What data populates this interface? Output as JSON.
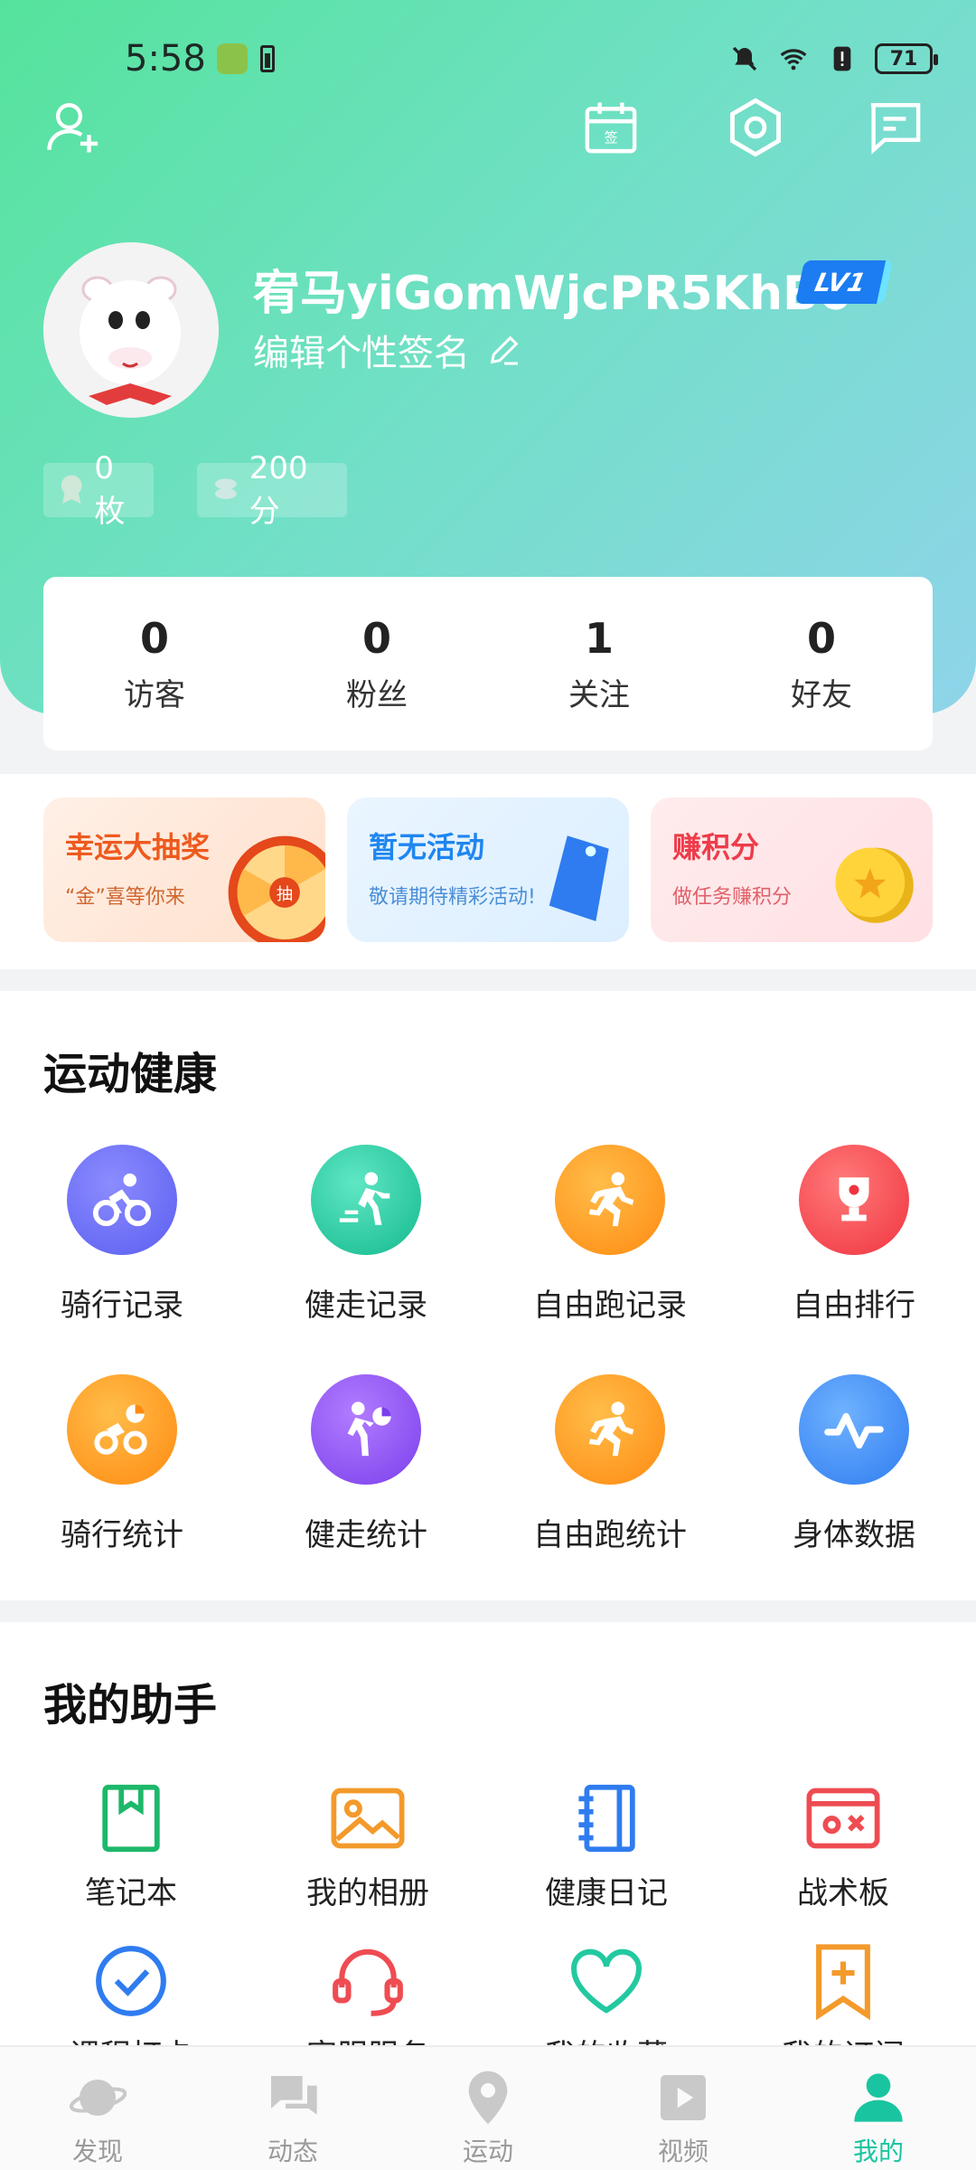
{
  "status": {
    "time": "5:58",
    "battery": "71"
  },
  "profile": {
    "username": "宥马yiGomWjcPR5KhB6",
    "level": "LV1",
    "signature": "编辑个性签名",
    "medals": "0枚",
    "points": "200分",
    "checkin_icon_text": "签"
  },
  "stats": [
    {
      "value": "0",
      "label": "访客"
    },
    {
      "value": "0",
      "label": "粉丝"
    },
    {
      "value": "1",
      "label": "关注"
    },
    {
      "value": "0",
      "label": "好友"
    }
  ],
  "promos": [
    {
      "title": "幸运大抽奖",
      "sub": "“金”喜等你来",
      "wheel_text": "抽"
    },
    {
      "title": "暂无活动",
      "sub": "敬请期待精彩活动!"
    },
    {
      "title": "赚积分",
      "sub": "做任务赚积分"
    }
  ],
  "sports": {
    "title": "运动健康",
    "items": [
      {
        "label": "骑行记录",
        "icon": "cycling-icon",
        "color": "#6d6cf6"
      },
      {
        "label": "健走记录",
        "icon": "walking-icon",
        "color": "#23c9a0"
      },
      {
        "label": "自由跑记录",
        "icon": "running-icon",
        "color": "#ff9a1f"
      },
      {
        "label": "自由排行",
        "icon": "trophy-icon",
        "color": "#f54b57"
      },
      {
        "label": "骑行统计",
        "icon": "cycling-stats-icon",
        "color": "#ff9a1f"
      },
      {
        "label": "健走统计",
        "icon": "walking-stats-icon",
        "color": "#8b56f0"
      },
      {
        "label": "自由跑统计",
        "icon": "running-stats-icon",
        "color": "#ff9a1f"
      },
      {
        "label": "身体数据",
        "icon": "pulse-icon",
        "color": "#3f8ff2"
      }
    ]
  },
  "assistant": {
    "title": "我的助手",
    "items": [
      {
        "label": "笔记本",
        "icon": "notebook-icon"
      },
      {
        "label": "我的相册",
        "icon": "album-icon"
      },
      {
        "label": "健康日记",
        "icon": "diary-icon"
      },
      {
        "label": "战术板",
        "icon": "tactics-board-icon"
      },
      {
        "label": "课程打卡",
        "icon": "check-circle-icon"
      },
      {
        "label": "客服服务",
        "icon": "headset-icon"
      },
      {
        "label": "我的收藏",
        "icon": "heart-icon"
      },
      {
        "label": "我的订阅",
        "icon": "bookmark-plus-icon"
      }
    ]
  },
  "nav": [
    {
      "label": "发现",
      "icon": "planet-icon"
    },
    {
      "label": "动态",
      "icon": "chat-bubbles-icon"
    },
    {
      "label": "运动",
      "icon": "location-pin-icon"
    },
    {
      "label": "视频",
      "icon": "play-icon"
    },
    {
      "label": "我的",
      "icon": "person-icon",
      "active": true
    }
  ]
}
